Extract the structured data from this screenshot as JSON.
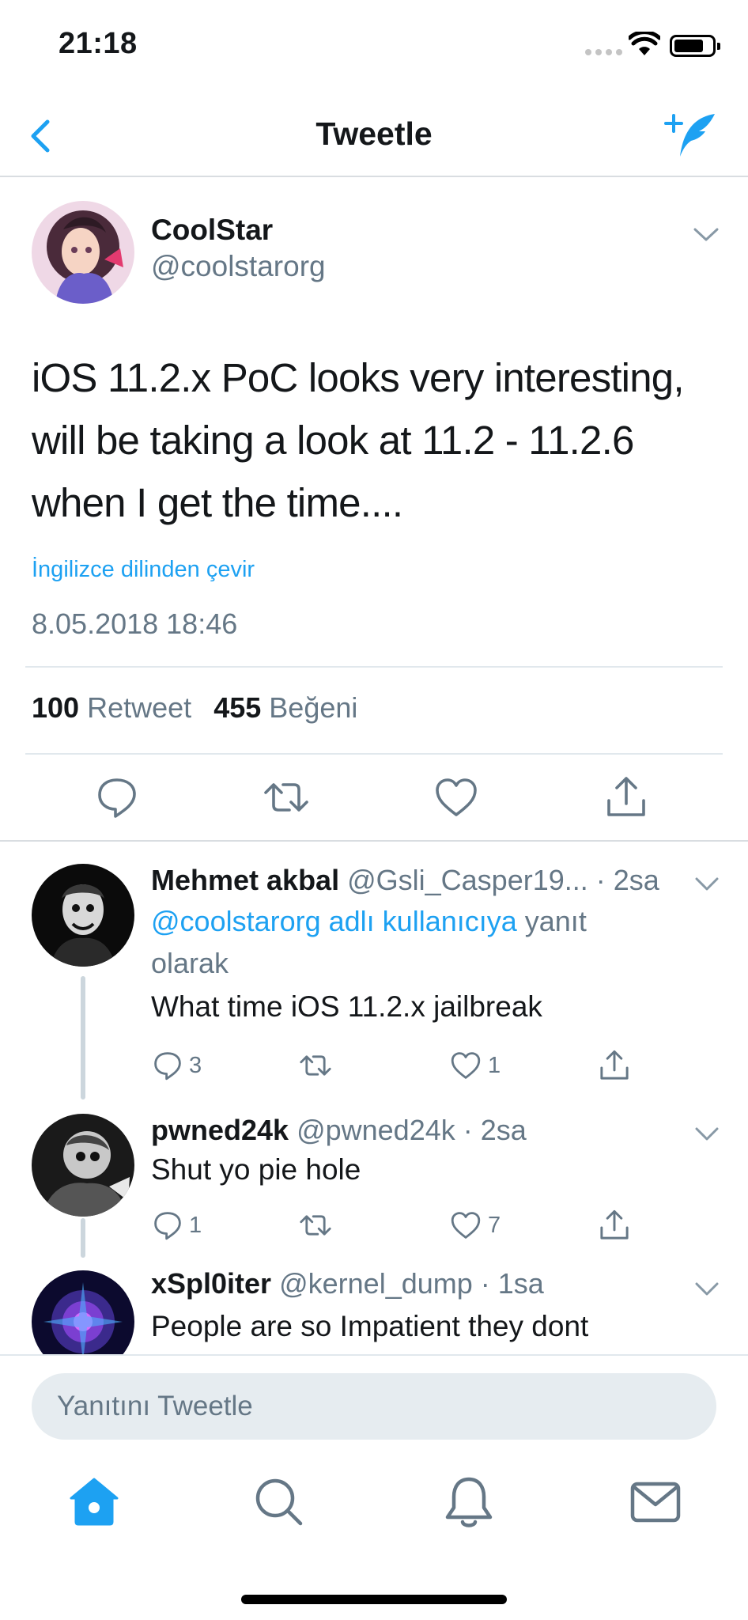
{
  "status_bar": {
    "time": "21:18"
  },
  "nav": {
    "title": "Tweetle",
    "back_icon": "chevron-left-icon",
    "compose_icon": "compose-tweet-icon"
  },
  "tweet": {
    "author_name": "CoolStar",
    "author_handle": "@coolstarorg",
    "text": "iOS 11.2.x PoC looks very interesting, will be taking a look at 11.2 - 11.2.6 when I get the time....",
    "translate_label": "İngilizce dilinden çevir",
    "date": "8.05.2018 18:46",
    "retweet_count": "100",
    "retweet_label": "Retweet",
    "like_count": "455",
    "like_label": "Beğeni"
  },
  "replies": [
    {
      "name": "Mehmet akbal",
      "handle": "@Gsli_Casper19...",
      "time": "· 2sa",
      "reply_to_mention": "@coolstarorg adlı kullanıcıya",
      "reply_to_suffix": " yanıt olarak",
      "text": "What time iOS 11.2.x jailbreak",
      "reply_count": "3",
      "retweet_count": "",
      "like_count": "1"
    },
    {
      "name": "pwned24k",
      "handle": "@pwned24k",
      "time": "· 2sa",
      "text": "Shut yo pie hole",
      "reply_count": "1",
      "retweet_count": "",
      "like_count": "7"
    },
    {
      "name": "xSpl0iter",
      "handle": "@kernel_dump",
      "time": "· 1sa",
      "text": "People are so Impatient they dont Understand What Developers Go"
    }
  ],
  "compose": {
    "placeholder": "Yanıtını Tweetle"
  },
  "tab_bar": {
    "tabs": [
      "home-icon",
      "search-icon",
      "notifications-icon",
      "messages-icon"
    ],
    "active": "home-icon"
  },
  "colors": {
    "accent": "#1da1f2",
    "secondary_text": "#657786",
    "divider": "#e1e8ed"
  }
}
